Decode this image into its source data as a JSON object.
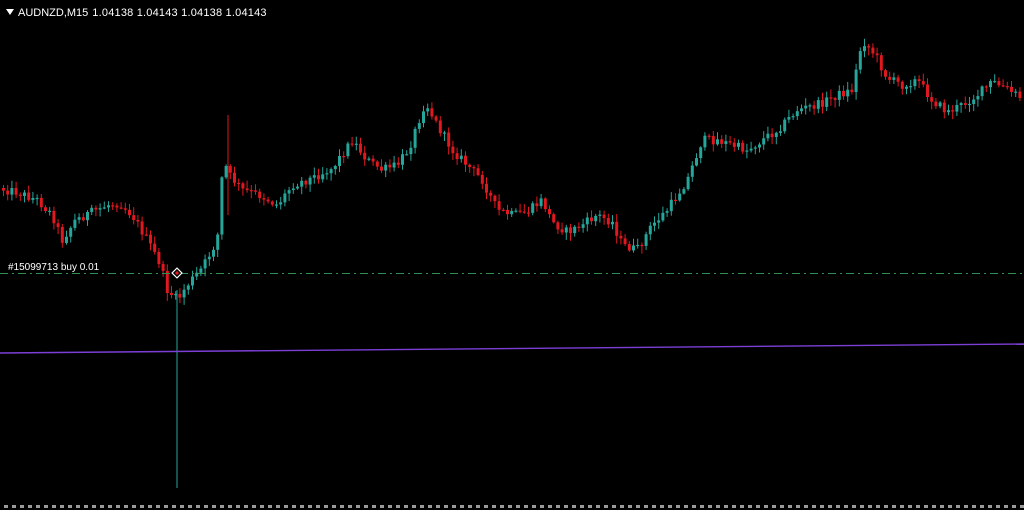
{
  "header": {
    "symbol": "AUDNZD,M15",
    "ohlc": "1.04138 1.04143 1.04138 1.04143"
  },
  "order": {
    "label": "#15099713 buy 0.01"
  },
  "colors": {
    "background": "#000000",
    "bull": "#26a69a",
    "bear": "#e0181f",
    "order_line": "#2f8f4f",
    "moving_average": "#7b3fd6",
    "text": "#ffffff"
  },
  "icons": {
    "header": "triangle-down-icon",
    "order_marker": "diamond-icon"
  }
}
